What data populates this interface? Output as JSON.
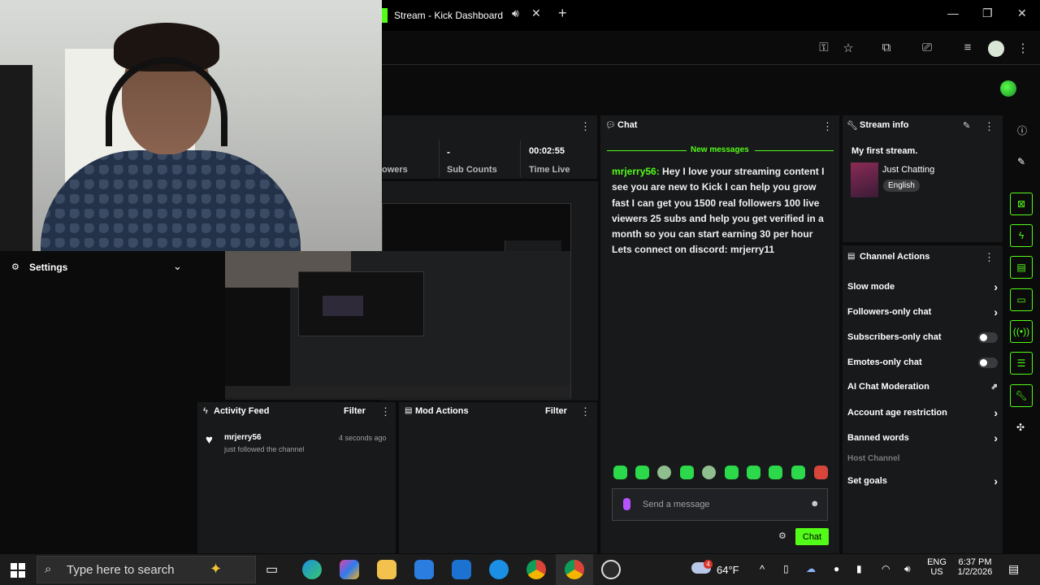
{
  "browser": {
    "tab_title": "Stream - Kick Dashboard",
    "icons": [
      "audio-icon",
      "close-icon",
      "plus-icon",
      "minimize-icon",
      "restore-icon",
      "close-window-icon",
      "key-icon",
      "star-icon",
      "extension-icon",
      "cast-icon",
      "playlist-icon",
      "profile-icon",
      "menu-icon"
    ]
  },
  "stats": {
    "followers_label": "owers",
    "subs_value": "-",
    "subs_label": "Sub Counts",
    "time_value": "00:02:55",
    "time_label": "Time Live"
  },
  "settings": {
    "title": "Settings"
  },
  "activity": {
    "title": "Activity Feed",
    "filter": "Filter",
    "items": [
      {
        "user": "mrjerry56",
        "time": "4 seconds ago",
        "text": "just followed the channel"
      }
    ]
  },
  "mod_actions": {
    "title": "Mod Actions",
    "filter": "Filter"
  },
  "chat": {
    "title": "Chat",
    "new_messages": "New messages",
    "messages": [
      {
        "user": "mrjerry56:",
        "text": " Hey I love your streaming content I see you are new to Kick I can help you grow fast I can get you 1500 real followers 100 live viewers 25 subs and help you get verified in a month so you can start earning 30 per hour Lets connect on discord: mrjerry11"
      }
    ],
    "input_placeholder": "Send a message",
    "send_label": "Chat"
  },
  "stream_info": {
    "title": "Stream info",
    "stream_title": "My first stream.",
    "category": "Just Chatting",
    "language": "English"
  },
  "channel_actions": {
    "title": "Channel Actions",
    "rows": [
      {
        "label": "Slow mode",
        "control": "chevron"
      },
      {
        "label": "Followers-only chat",
        "control": "chevron"
      },
      {
        "label": "Subscribers-only chat",
        "control": "toggle"
      },
      {
        "label": "Emotes-only chat",
        "control": "toggle"
      },
      {
        "label": "AI Chat Moderation",
        "control": "external"
      },
      {
        "label": "Account age restriction",
        "control": "chevron"
      },
      {
        "label": "Banned words",
        "control": "chevron"
      }
    ],
    "host_channel": "Host Channel",
    "set_goals": "Set goals"
  },
  "taskbar": {
    "search_placeholder": "Type here to search",
    "weather": "64°F",
    "weather_badge": "4",
    "lang1": "ENG",
    "lang2": "US",
    "time": "6:37 PM",
    "date": "1/2/2026"
  },
  "colors": {
    "accent": "#53fc18",
    "panel": "#18191b",
    "background": "#0b0b0c"
  }
}
